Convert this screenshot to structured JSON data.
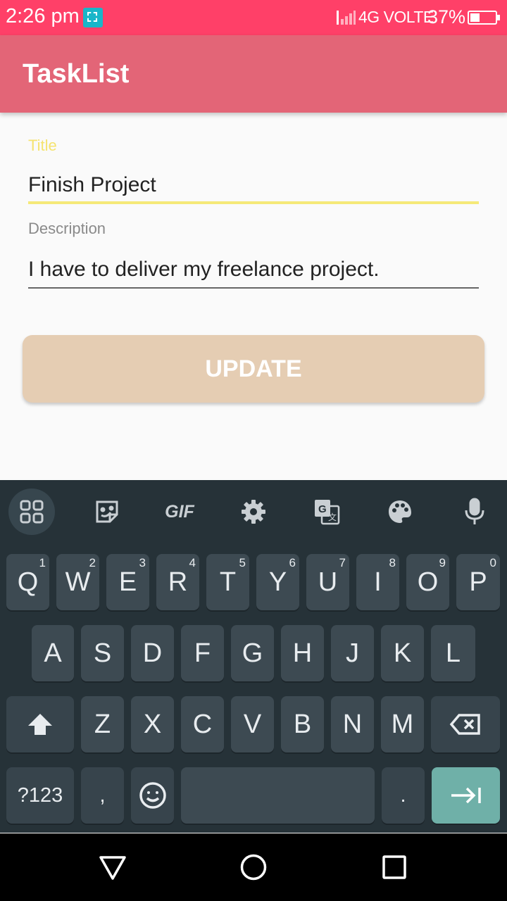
{
  "status_bar": {
    "time": "2:26 pm",
    "network": "4G VOLTE",
    "battery": "37%",
    "battery_level": 0.37
  },
  "app_bar": {
    "title": "TaskList"
  },
  "form": {
    "title_label": "Title",
    "title_value": "Finish Project",
    "description_label": "Description",
    "description_value": "I have to deliver my freelance project.",
    "update_label": "UPDATE"
  },
  "keyboard": {
    "toolbar": [
      "apps-icon",
      "sticker-icon",
      "GIF",
      "settings-icon",
      "translate-icon",
      "palette-icon",
      "mic-icon"
    ],
    "row1": [
      {
        "label": "Q",
        "hint": "1"
      },
      {
        "label": "W",
        "hint": "2"
      },
      {
        "label": "E",
        "hint": "3"
      },
      {
        "label": "R",
        "hint": "4"
      },
      {
        "label": "T",
        "hint": "5"
      },
      {
        "label": "Y",
        "hint": "6"
      },
      {
        "label": "U",
        "hint": "7"
      },
      {
        "label": "I",
        "hint": "8"
      },
      {
        "label": "O",
        "hint": "9"
      },
      {
        "label": "P",
        "hint": "0"
      }
    ],
    "row2": [
      "A",
      "S",
      "D",
      "F",
      "G",
      "H",
      "J",
      "K",
      "L"
    ],
    "row3": [
      "Z",
      "X",
      "C",
      "V",
      "B",
      "N",
      "M"
    ],
    "symbols_label": "?123",
    "comma_label": ",",
    "period_label": "."
  },
  "colors": {
    "status_bar": "#ff4068",
    "app_bar": "#e36577",
    "title_accent": "#f5e36f",
    "update_button": "#e5cdb3",
    "keyboard": "#263238",
    "enter_key": "#6fb0a8"
  }
}
